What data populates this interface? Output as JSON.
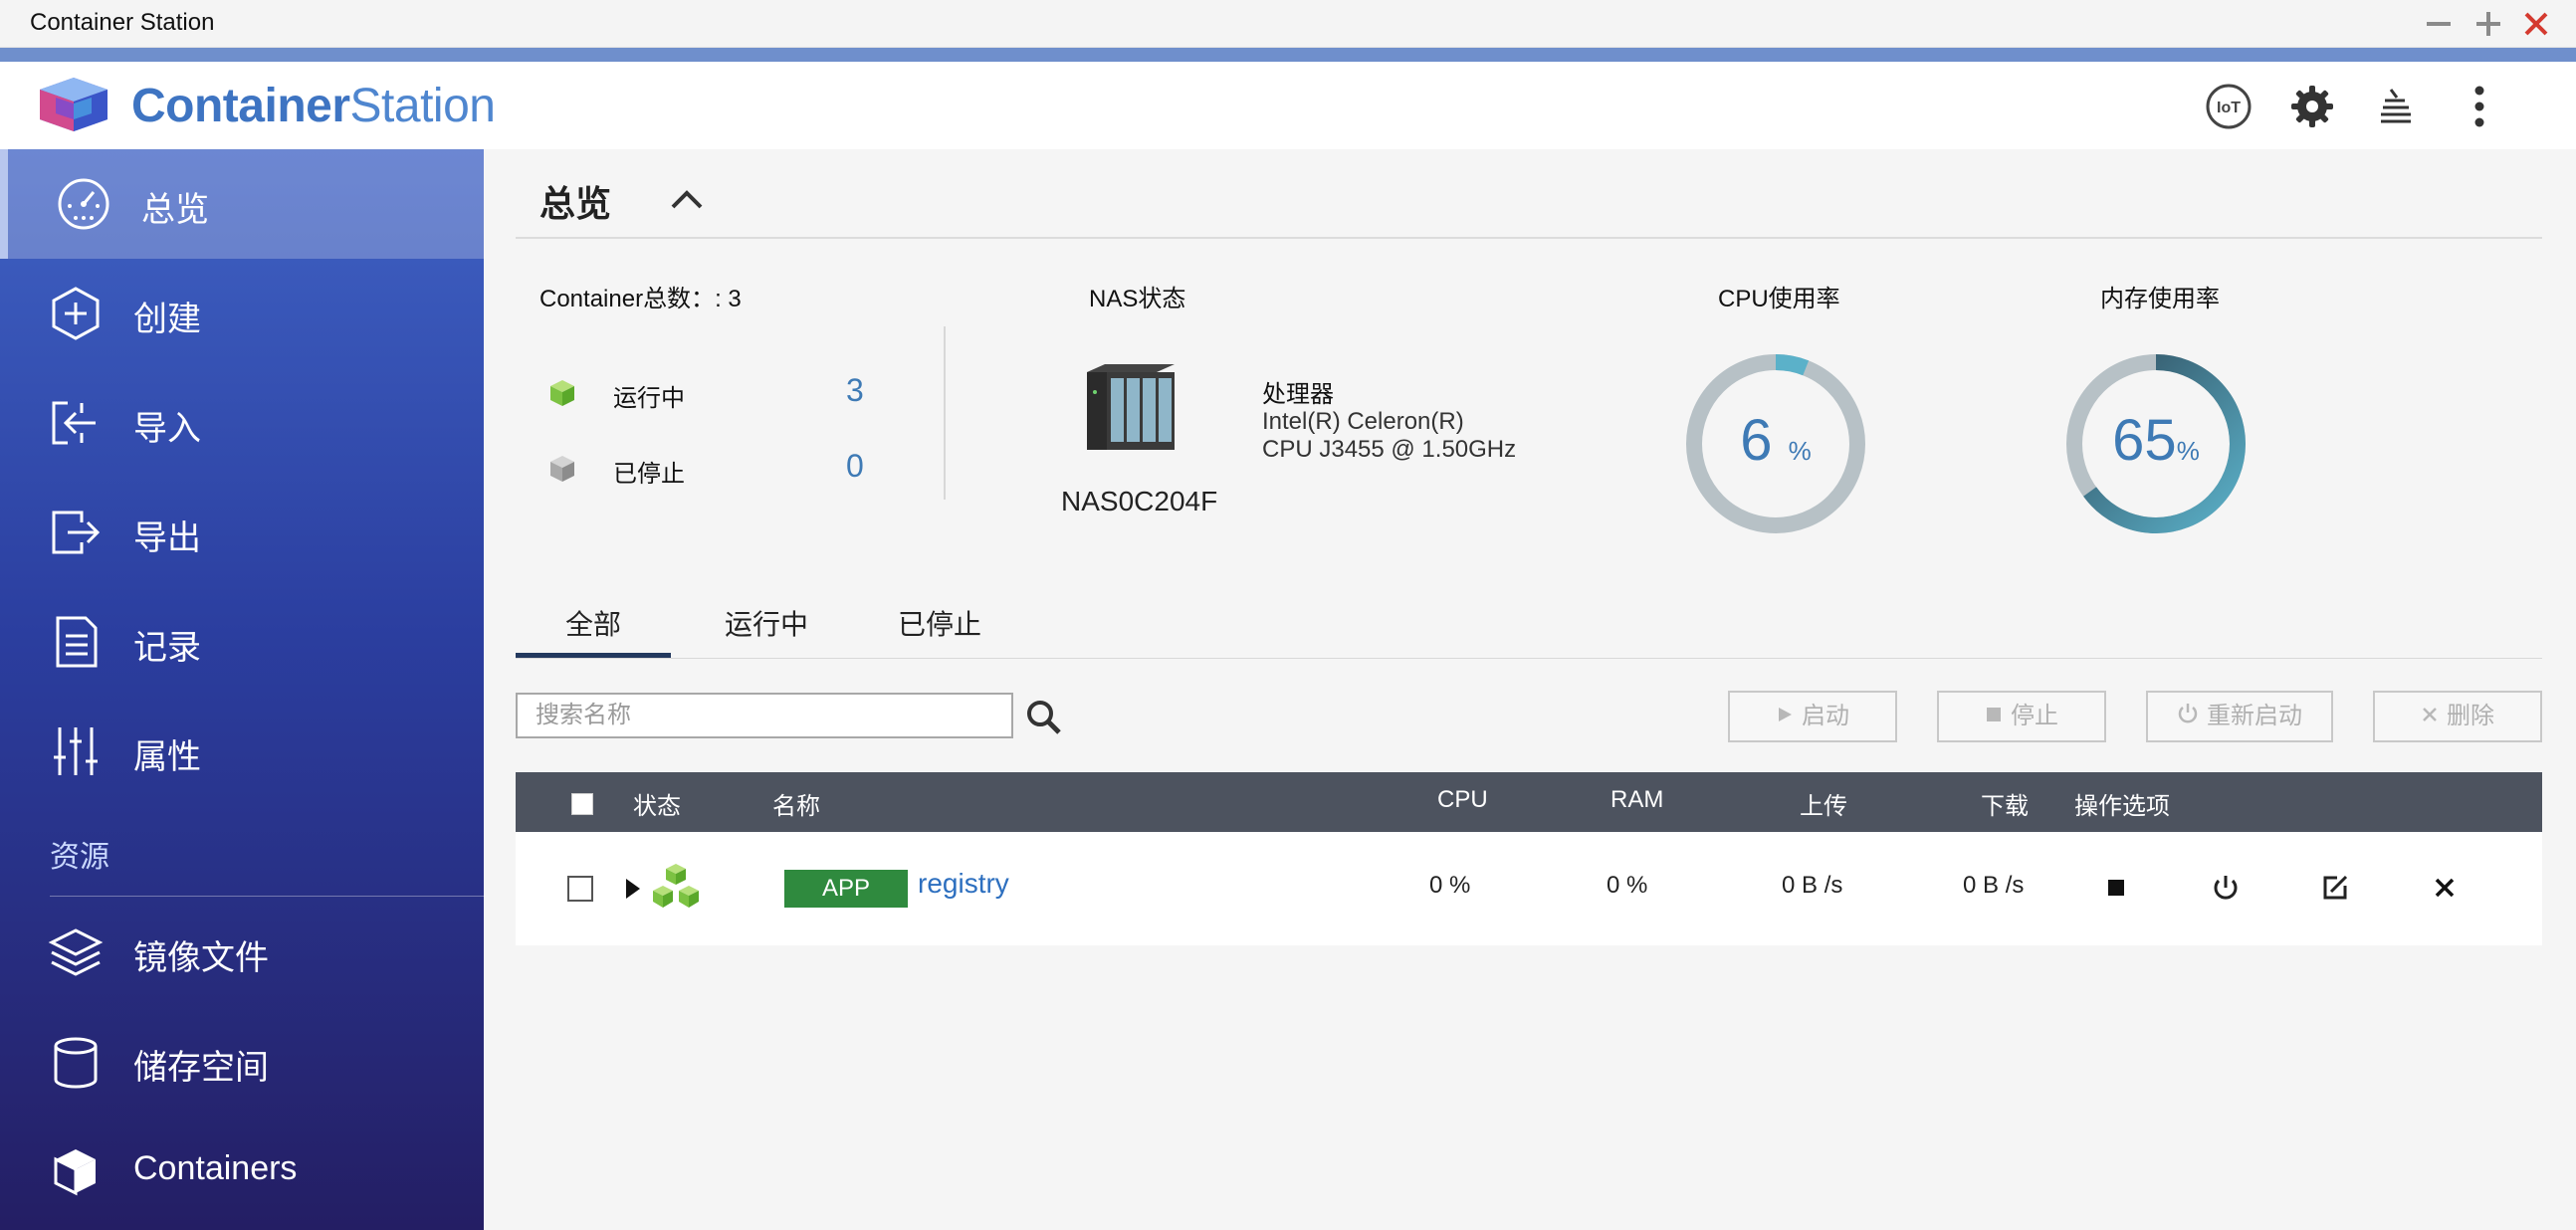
{
  "window": {
    "title": "Container Station"
  },
  "header": {
    "brand_bold": "Container",
    "brand_light": "Station",
    "iot_label": "IoT"
  },
  "sidebar": {
    "items": [
      {
        "label": "总览"
      },
      {
        "label": "创建"
      },
      {
        "label": "导入"
      },
      {
        "label": "导出"
      },
      {
        "label": "记录"
      },
      {
        "label": "属性"
      }
    ],
    "section_resources": "资源",
    "resource_items": [
      {
        "label": "镜像文件"
      },
      {
        "label": "储存空间"
      },
      {
        "label": "Containers"
      }
    ]
  },
  "overview": {
    "title": "总览",
    "container_total_label": "Container总数：",
    "container_total_value": ": 3",
    "running_label": "运行中",
    "running_count": "3",
    "stopped_label": "已停止",
    "stopped_count": "0",
    "nas_status_label": "NAS状态",
    "nas_name": "NAS0C204F",
    "processor_label": "处理器",
    "processor_line1": "Intel(R) Celeron(R)",
    "processor_line2": "CPU J3455 @ 1.50GHz",
    "cpu_label": "CPU使用率",
    "cpu_value": "6",
    "cpu_percent": 6,
    "mem_label": "内存使用率",
    "mem_value": "65",
    "mem_percent": 65,
    "percent_sign": "%"
  },
  "tabs": [
    {
      "label": "全部",
      "active": true
    },
    {
      "label": "运行中"
    },
    {
      "label": "已停止"
    }
  ],
  "toolbar": {
    "search_placeholder": "搜索名称",
    "start_label": "启动",
    "stop_label": "停止",
    "restart_label": "重新启动",
    "delete_label": "删除"
  },
  "table": {
    "headers": {
      "status": "状态",
      "name": "名称",
      "cpu": "CPU",
      "ram": "RAM",
      "upload": "上传",
      "download": "下载",
      "actions": "操作选项"
    },
    "rows": [
      {
        "type_badge": "APP",
        "name": "registry",
        "cpu": "0 %",
        "ram": "0 %",
        "upload": "0 B /s",
        "download": "0 B /s"
      }
    ]
  },
  "colors": {
    "accent": "#3e74c2",
    "sidebar_top": "#3f62c4",
    "sidebar_bottom": "#241e64",
    "gauge_track": "#b7c1c6",
    "gauge_fill_light": "#5bb1c9",
    "gauge_fill_dark": "#2f4c5d",
    "app_badge": "#2f8a3e",
    "value_blue": "#3e7ab5"
  },
  "icons": {
    "window": [
      "minimize-icon",
      "maximize-icon",
      "close-icon"
    ],
    "header": [
      "iot-icon",
      "settings-gear-icon",
      "stack-icon",
      "more-vertical-icon"
    ],
    "sidebar": [
      "dashboard-gauge-icon",
      "plus-hexagon-icon",
      "import-icon",
      "export-icon",
      "document-icon",
      "sliders-icon",
      "layers-icon",
      "cylinder-icon",
      "cube-icon"
    ],
    "row_actions": [
      "stop-icon",
      "power-icon",
      "edit-icon",
      "delete-x-icon"
    ]
  }
}
